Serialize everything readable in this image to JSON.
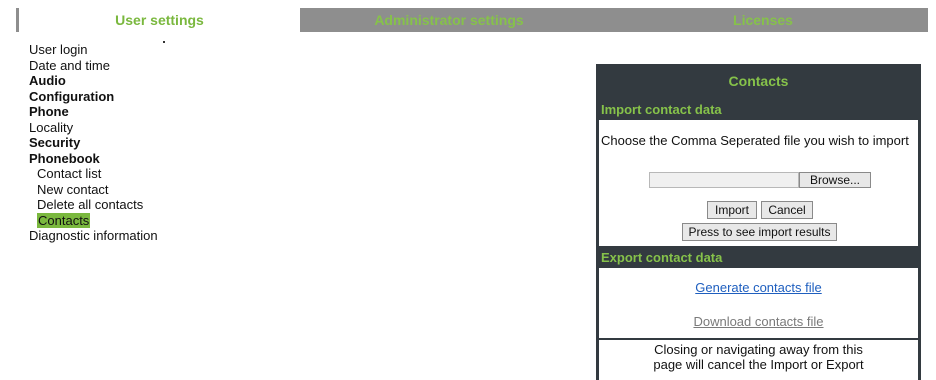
{
  "tabs": [
    {
      "label": "User settings"
    },
    {
      "label": "Administrator settings"
    },
    {
      "label": "Licenses"
    }
  ],
  "nav": {
    "items": [
      {
        "label": "User login"
      },
      {
        "label": "Date and time"
      },
      {
        "label": "Audio"
      },
      {
        "label": "Configuration"
      },
      {
        "label": "Phone"
      },
      {
        "label": "Locality"
      },
      {
        "label": "Security"
      },
      {
        "label": "Phonebook"
      },
      {
        "label": "Contact list"
      },
      {
        "label": "New contact"
      },
      {
        "label": "Delete all contacts"
      },
      {
        "label": "Contacts"
      },
      {
        "label": "Diagnostic information"
      }
    ]
  },
  "panel": {
    "title": "Contacts",
    "import": {
      "heading": "Import contact data",
      "instruction": "Choose the Comma Seperated file you wish to import",
      "file_value": "",
      "browse_label": "Browse...",
      "import_label": "Import",
      "cancel_label": "Cancel",
      "results_label": "Press to see import results"
    },
    "export": {
      "heading": "Export contact data",
      "generate_label": "Generate contacts file",
      "download_label": "Download contacts file"
    },
    "note": {
      "line1": "Closing or navigating away from this",
      "line2": "page will cancel the Import or Export"
    }
  },
  "colors": {
    "accent_green": "#7ab83e",
    "panel_dark": "#333a40",
    "tab_gray": "#8e8e8e",
    "link_blue": "#1f5fbf"
  }
}
